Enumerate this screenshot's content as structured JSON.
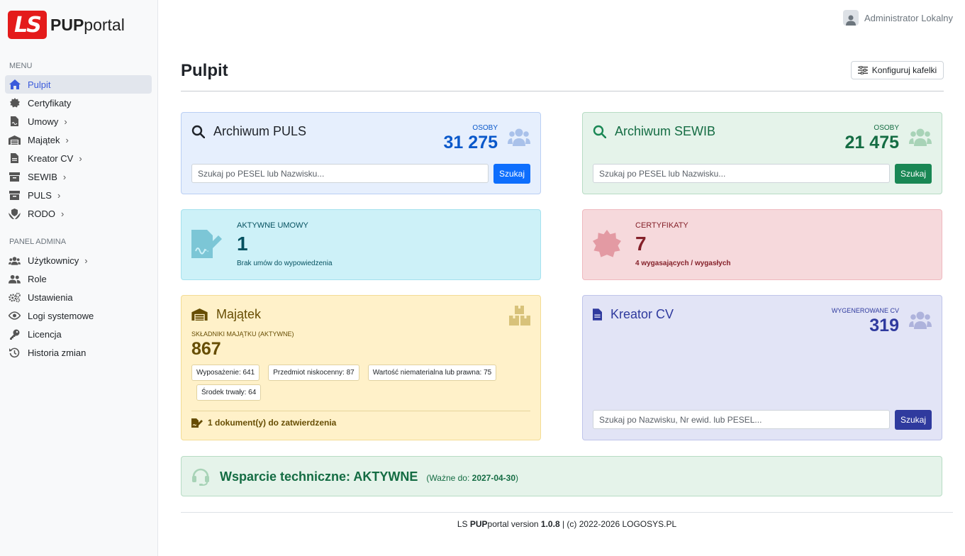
{
  "logo": {
    "badge": "LS",
    "brand_bold": "PUP",
    "brand_rest": "portal"
  },
  "sidebar": {
    "menu_label": "MENU",
    "menu_items": [
      {
        "label": "Pulpit",
        "icon": "home-icon",
        "active": true,
        "has_chevron": false
      },
      {
        "label": "Certyfikaty",
        "icon": "certificate-icon",
        "has_chevron": false
      },
      {
        "label": "Umowy",
        "icon": "contract-icon",
        "has_chevron": true
      },
      {
        "label": "Majątek",
        "icon": "warehouse-icon",
        "has_chevron": true
      },
      {
        "label": "Kreator CV",
        "icon": "file-icon",
        "has_chevron": true
      },
      {
        "label": "SEWIB",
        "icon": "archive-icon",
        "has_chevron": true
      },
      {
        "label": "PULS",
        "icon": "archive-icon",
        "has_chevron": true
      },
      {
        "label": "RODO",
        "icon": "shield-hands-icon",
        "has_chevron": true
      }
    ],
    "admin_label": "PANEL ADMINA",
    "admin_items": [
      {
        "label": "Użytkownicy",
        "icon": "users-icon",
        "has_chevron": true
      },
      {
        "label": "Role",
        "icon": "user-group-icon",
        "has_chevron": false
      },
      {
        "label": "Ustawienia",
        "icon": "gears-icon",
        "has_chevron": false
      },
      {
        "label": "Logi systemowe",
        "icon": "eye-icon",
        "has_chevron": false
      },
      {
        "label": "Licencja",
        "icon": "key-icon",
        "has_chevron": false
      },
      {
        "label": "Historia zmian",
        "icon": "history-icon",
        "has_chevron": false
      }
    ]
  },
  "user": {
    "name": "Administrator Lokalny"
  },
  "header": {
    "title": "Pulpit",
    "config_button": "Konfiguruj kafelki"
  },
  "cards": {
    "puls": {
      "title": "Archiwum PULS",
      "stat_label": "OSOBY",
      "stat_value": "31 275",
      "placeholder": "Szukaj po PESEL lub Nazwisku...",
      "button": "Szukaj",
      "color": "#0d6efd",
      "text_color": "#0a58ca"
    },
    "sewib": {
      "title": "Archiwum SEWIB",
      "stat_label": "OSOBY",
      "stat_value": "21 475",
      "placeholder": "Szukaj po PESEL lub Nazwisku...",
      "button": "Szukaj",
      "color": "#198754",
      "text_color": "#146c43"
    },
    "umowy": {
      "label": "AKTYWNE UMOWY",
      "value": "1",
      "sub": "Brak umów do wypowiedzenia"
    },
    "cert": {
      "label": "CERTYFIKATY",
      "value": "7",
      "sub": "4 wygasających / wygasłych"
    },
    "majatek": {
      "title": "Majątek",
      "label": "SKŁADNIKI MAJĄTKU (AKTYWNE)",
      "value": "867",
      "chips": [
        "Wyposażenie: 641",
        "Przedmiot niskocenny: 87",
        "Wartość niematerialna lub prawna: 75",
        "Środek trwały: 64"
      ],
      "pending": "1 dokument(y) do zatwierdzenia"
    },
    "cv": {
      "title": "Kreator CV",
      "stat_label": "WYGENEROWANE CV",
      "stat_value": "319",
      "placeholder": "Szukaj po Nazwisku, Nr ewid. lub PESEL...",
      "button": "Szukaj",
      "color": "#2f3a9e"
    },
    "support": {
      "title": "Wsparcie techniczne: AKTYWNE",
      "valid_prefix": "(Ważne do: ",
      "valid_date": "2027-04-30",
      "valid_suffix": ")"
    }
  },
  "footer": {
    "prefix": "LS ",
    "brand_bold": "PUP",
    "brand_rest": "portal version ",
    "version": "1.0.8",
    "suffix": " | (c) 2022-2026 LOGOSYS.PL"
  }
}
